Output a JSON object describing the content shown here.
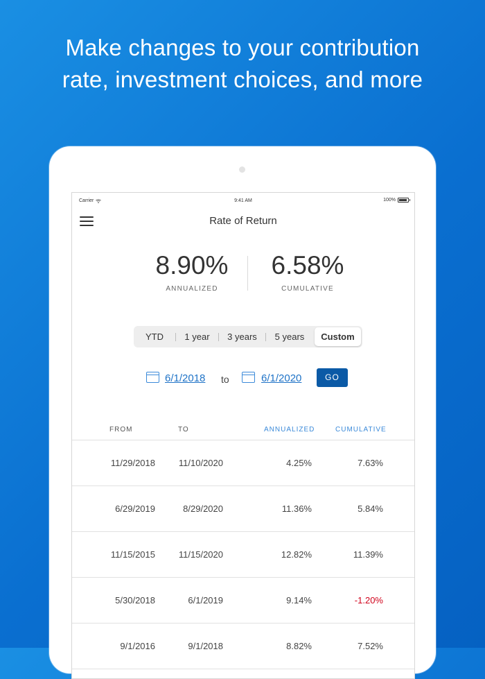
{
  "headline": {
    "line1": "Make changes to your contribution",
    "line2": "rate, investment choices, and more"
  },
  "status_bar": {
    "carrier": "Carrier",
    "time": "9:41 AM",
    "battery": "100%"
  },
  "nav": {
    "title": "Rate of Return"
  },
  "summary": {
    "annualized_value": "8.90%",
    "annualized_label": "ANNUALIZED",
    "cumulative_value": "6.58%",
    "cumulative_label": "CUMULATIVE"
  },
  "periods": {
    "options": [
      "YTD",
      "1 year",
      "3 years",
      "5 years",
      "Custom"
    ],
    "selected": "Custom"
  },
  "date_range": {
    "from": "6/1/2018",
    "to_label": "to",
    "to": "6/1/2020",
    "go_label": "GO"
  },
  "table": {
    "headers": {
      "from": "FROM",
      "to": "TO",
      "annualized": "ANNUALIZED",
      "cumulative": "CUMULATIVE"
    },
    "rows": [
      {
        "from": "11/29/2018",
        "to": "11/10/2020",
        "annualized": "4.25%",
        "cumulative": "7.63%"
      },
      {
        "from": "6/29/2019",
        "to": "8/29/2020",
        "annualized": "11.36%",
        "cumulative": "5.84%"
      },
      {
        "from": "11/15/2015",
        "to": "11/15/2020",
        "annualized": "12.82%",
        "cumulative": "11.39%"
      },
      {
        "from": "5/30/2018",
        "to": "6/1/2019",
        "annualized": "9.14%",
        "cumulative": "-1.20%"
      },
      {
        "from": "9/1/2016",
        "to": "9/1/2018",
        "annualized": "8.82%",
        "cumulative": "7.52%"
      }
    ]
  },
  "colors": {
    "background": "#0a6fd0",
    "accent_blue": "#3b8ad9",
    "go_button": "#0b5aa6",
    "negative": "#d0021b"
  },
  "icons": {
    "menu": "hamburger-menu-icon",
    "calendar": "calendar-icon",
    "wifi": "wifi-icon",
    "battery": "battery-icon"
  }
}
